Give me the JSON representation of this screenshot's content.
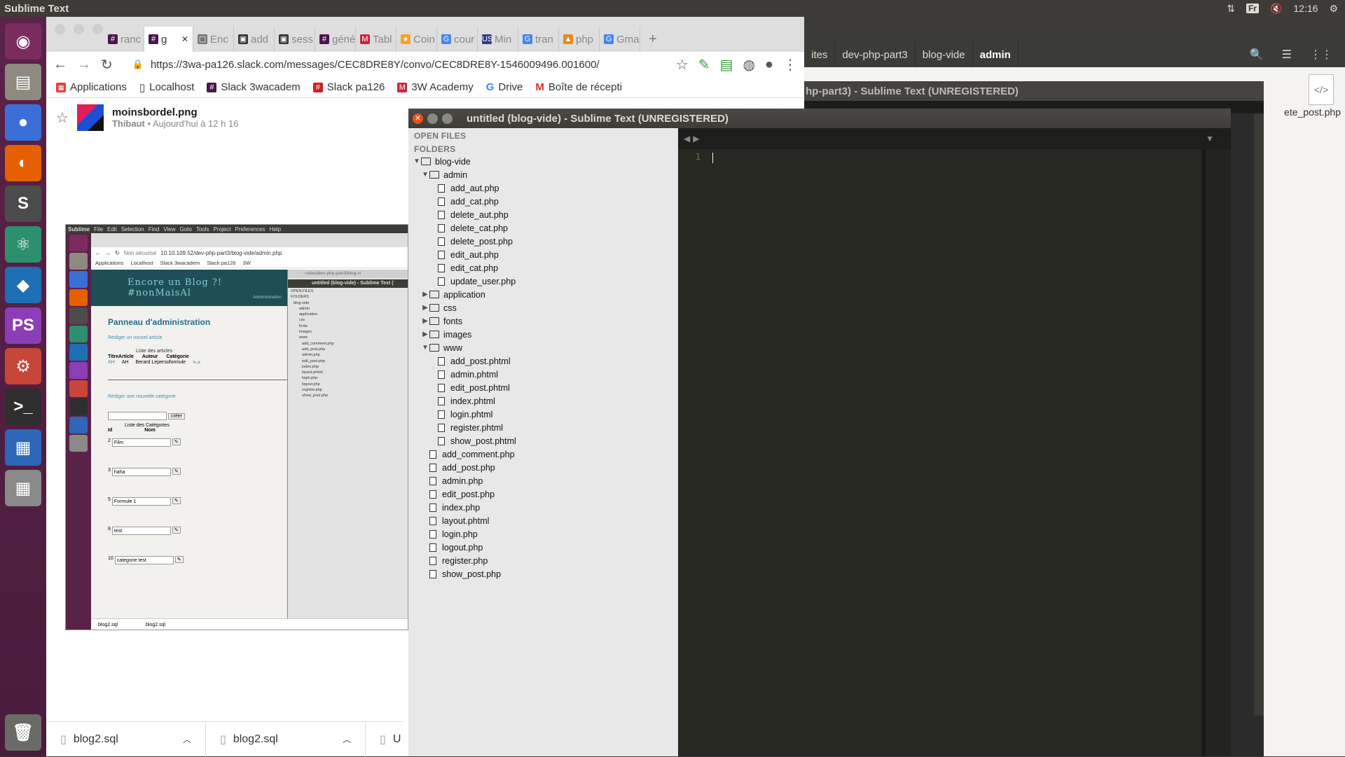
{
  "top_panel": {
    "title": "Sublime Text",
    "lang": "Fr",
    "clock": "12:16"
  },
  "launcher": {
    "items": [
      {
        "name": "ubuntu-dash-icon",
        "glyph": "◉",
        "bg": "#7a2c5e"
      },
      {
        "name": "files-icon",
        "glyph": "▤",
        "bg": "#8e8a80"
      },
      {
        "name": "chrome-icon",
        "glyph": "●",
        "bg": "#3b6fd8"
      },
      {
        "name": "firefox-icon",
        "glyph": "◐",
        "bg": "#e66000"
      },
      {
        "name": "sublime-icon",
        "glyph": "S",
        "bg": "#4c4c4c"
      },
      {
        "name": "atom-icon",
        "glyph": "⚛",
        "bg": "#2c8f6f"
      },
      {
        "name": "vscode-icon",
        "glyph": "◆",
        "bg": "#1f6fb5"
      },
      {
        "name": "phpstorm-icon",
        "glyph": "PS",
        "bg": "#8b3eb5"
      },
      {
        "name": "settings-icon",
        "glyph": "⚙",
        "bg": "#c8453a"
      },
      {
        "name": "terminal-icon",
        "glyph": ">_",
        "bg": "#2f2f2f"
      },
      {
        "name": "writer-icon",
        "glyph": "▦",
        "bg": "#2e66b8"
      },
      {
        "name": "calc-icon",
        "glyph": "▦",
        "bg": "#8a8a8a"
      }
    ],
    "trash": {
      "name": "trash-icon",
      "glyph": "🗑"
    }
  },
  "background_window": {
    "crumbs": [
      "ites",
      "dev-php-part3",
      "blog-vide",
      "admin"
    ],
    "title_fragment": "hp-part3) - Sublime Text (UNREGISTERED)",
    "file_label": "ete_post.php"
  },
  "chrome": {
    "tabs": [
      {
        "label": "ranc",
        "icon": "#",
        "color": "#4a154b"
      },
      {
        "label": "g",
        "icon": "#",
        "color": "#4a154b",
        "active": true
      },
      {
        "label": "Enc",
        "icon": "▢",
        "color": "#777"
      },
      {
        "label": "add",
        "icon": "▣",
        "color": "#333"
      },
      {
        "label": "sess",
        "icon": "▣",
        "color": "#333"
      },
      {
        "label": "géné",
        "icon": "#",
        "color": "#4a154b"
      },
      {
        "label": "Tabl",
        "icon": "M",
        "color": "#c6283b"
      },
      {
        "label": "Coin",
        "icon": "●",
        "color": "#f5a623"
      },
      {
        "label": "cour",
        "icon": "G",
        "color": "#4285f4"
      },
      {
        "label": "Min",
        "icon": "US",
        "color": "#2d3b8a"
      },
      {
        "label": "tran",
        "icon": "G",
        "color": "#4285f4"
      },
      {
        "label": "php",
        "icon": "▲",
        "color": "#e38c1f"
      },
      {
        "label": "Gma",
        "icon": "G",
        "color": "#4285f4"
      }
    ],
    "close_glyph": "✕",
    "new_tab": "+",
    "url": "https://3wa-pa126.slack.com/messages/CEC8DRE8Y/convo/CEC8DRE8Y-1546009496.001600/",
    "bookmarks": [
      "Applications",
      "Localhost",
      "Slack 3wacadem",
      "Slack pa126",
      "3W Academy",
      "Drive",
      "Boîte de récepti"
    ],
    "file": {
      "name": "moinsbordel.png",
      "author": "Thibaut",
      "time": "Aujourd'hui à 12 h 16"
    },
    "downloads": [
      "blog2.sql",
      "blog2.sql",
      "U"
    ]
  },
  "embedded": {
    "menu": [
      "Sublime",
      "File",
      "Edit",
      "Selection",
      "Find",
      "View",
      "Goto",
      "Tools",
      "Project",
      "Preferences",
      "Help"
    ],
    "url": "10.10.109.52/dev-php-part3/blog-vide/admin.php",
    "not_secure": "Non sécurisé",
    "bookmarks": [
      "Applications",
      "Localhost",
      "Slack 3wacadem",
      "Slack pa126",
      "3W"
    ],
    "banner": "Encore un Blog ?! #nonMaisAl",
    "banner_link": "Administration",
    "admin_title": "Panneau d'administration",
    "new_article": "Rédiger un nouvel article",
    "list_title": "Liste des articles",
    "cols": [
      "TitreArticle",
      "Auteur",
      "Catégorie"
    ],
    "row": [
      "AH",
      "AH",
      "Berard Lepersoformule"
    ],
    "new_cat": "Rédiger une nouvelle catégorie",
    "create": "créer",
    "cat_title": "Liste des Catégories",
    "cat_cols": [
      "Id",
      "Nom"
    ],
    "cats": [
      {
        "id": "2",
        "name": "Film"
      },
      {
        "id": "3",
        "name": "haha"
      },
      {
        "id": "5",
        "name": "Formule 1"
      },
      {
        "id": "8",
        "name": "test"
      },
      {
        "id": "10",
        "name": "categorie test"
      }
    ],
    "sublime_title": "untitled (blog-vide) - Sublime Text (",
    "sublime_path": "~/sites/dev-php-part3/blog-vi",
    "tree": [
      "OPEN FILES",
      "FOLDERS",
      "blog-vide",
      "admin",
      "application",
      "css",
      "fonts",
      "images",
      "www",
      "add_comment.php",
      "add_post.php",
      "admin.php",
      "edit_post.php",
      "index.php",
      "layout.phtml",
      "login.php",
      "logout.php",
      "register.php",
      "show_post.php"
    ],
    "downloads": [
      "blog2.sql",
      "blog2.sql"
    ]
  },
  "sublime": {
    "title": "untitled (blog-vide) - Sublime Text (UNREGISTERED)",
    "open_files": "OPEN FILES",
    "folders": "FOLDERS",
    "tree": [
      {
        "label": "blog-vide",
        "depth": 0,
        "type": "folder",
        "open": true
      },
      {
        "label": "admin",
        "depth": 1,
        "type": "folder",
        "open": true
      },
      {
        "label": "add_aut.php",
        "depth": 2,
        "type": "file"
      },
      {
        "label": "add_cat.php",
        "depth": 2,
        "type": "file"
      },
      {
        "label": "delete_aut.php",
        "depth": 2,
        "type": "file"
      },
      {
        "label": "delete_cat.php",
        "depth": 2,
        "type": "file"
      },
      {
        "label": "delete_post.php",
        "depth": 2,
        "type": "file"
      },
      {
        "label": "edit_aut.php",
        "depth": 2,
        "type": "file"
      },
      {
        "label": "edit_cat.php",
        "depth": 2,
        "type": "file"
      },
      {
        "label": "update_user.php",
        "depth": 2,
        "type": "file"
      },
      {
        "label": "application",
        "depth": 1,
        "type": "folder",
        "open": false
      },
      {
        "label": "css",
        "depth": 1,
        "type": "folder",
        "open": false
      },
      {
        "label": "fonts",
        "depth": 1,
        "type": "folder",
        "open": false
      },
      {
        "label": "images",
        "depth": 1,
        "type": "folder",
        "open": false
      },
      {
        "label": "www",
        "depth": 1,
        "type": "folder",
        "open": true
      },
      {
        "label": "add_post.phtml",
        "depth": 2,
        "type": "file"
      },
      {
        "label": "admin.phtml",
        "depth": 2,
        "type": "file"
      },
      {
        "label": "edit_post.phtml",
        "depth": 2,
        "type": "file"
      },
      {
        "label": "index.phtml",
        "depth": 2,
        "type": "file"
      },
      {
        "label": "login.phtml",
        "depth": 2,
        "type": "file"
      },
      {
        "label": "register.phtml",
        "depth": 2,
        "type": "file"
      },
      {
        "label": "show_post.phtml",
        "depth": 2,
        "type": "file"
      },
      {
        "label": "add_comment.php",
        "depth": 1,
        "type": "file"
      },
      {
        "label": "add_post.php",
        "depth": 1,
        "type": "file"
      },
      {
        "label": "admin.php",
        "depth": 1,
        "type": "file"
      },
      {
        "label": "edit_post.php",
        "depth": 1,
        "type": "file"
      },
      {
        "label": "index.php",
        "depth": 1,
        "type": "file"
      },
      {
        "label": "layout.phtml",
        "depth": 1,
        "type": "file"
      },
      {
        "label": "login.php",
        "depth": 1,
        "type": "file"
      },
      {
        "label": "logout.php",
        "depth": 1,
        "type": "file"
      },
      {
        "label": "register.php",
        "depth": 1,
        "type": "file"
      },
      {
        "label": "show_post.php",
        "depth": 1,
        "type": "file"
      }
    ],
    "line_number": "1"
  }
}
